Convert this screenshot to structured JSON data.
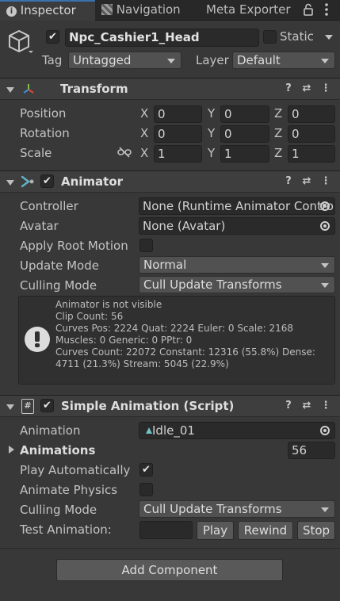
{
  "tabs": [
    {
      "label": "Inspector"
    },
    {
      "label": "Navigation"
    },
    {
      "label": "Meta Exporter"
    }
  ],
  "object": {
    "name": "Npc_Cashier1_Head",
    "static_label": "Static",
    "tag_label": "Tag",
    "tag_value": "Untagged",
    "layer_label": "Layer",
    "layer_value": "Default"
  },
  "transform": {
    "title": "Transform",
    "rows": [
      {
        "label": "Position",
        "x": "0",
        "y": "0",
        "z": "0"
      },
      {
        "label": "Rotation",
        "x": "0",
        "y": "0",
        "z": "0"
      },
      {
        "label": "Scale",
        "x": "1",
        "y": "1",
        "z": "1"
      }
    ],
    "axis": {
      "x": "X",
      "y": "Y",
      "z": "Z"
    }
  },
  "animator": {
    "title": "Animator",
    "controller_label": "Controller",
    "controller_value": "None (Runtime Animator Controller)",
    "avatar_label": "Avatar",
    "avatar_value": "None (Avatar)",
    "apply_root_motion_label": "Apply Root Motion",
    "update_mode_label": "Update Mode",
    "update_mode_value": "Normal",
    "culling_mode_label": "Culling Mode",
    "culling_mode_value": "Cull Update Transforms",
    "info_lines": [
      "Animator is not visible",
      "Clip Count: 56",
      "Curves Pos: 2224 Quat: 2224 Euler: 0 Scale: 2168",
      "Muscles: 0 Generic: 0 PPtr: 0",
      "Curves Count: 22072 Constant: 12316 (55.8%) Dense:",
      "4711 (21.3%) Stream: 5045 (22.9%)"
    ]
  },
  "simple_animation": {
    "title": "Simple Animation (Script)",
    "animation_label": "Animation",
    "animation_value": "Idle_01",
    "animations_label": "Animations",
    "animations_count": "56",
    "play_auto_label": "Play Automatically",
    "animate_physics_label": "Animate Physics",
    "culling_mode_label": "Culling Mode",
    "culling_mode_value": "Cull Update Transforms",
    "test_label": "Test Animation:",
    "play_button": "Play",
    "rewind_button": "Rewind",
    "stop_button": "Stop"
  },
  "add_component": "Add Component",
  "colors": {
    "accent": "#3a72b0",
    "panel": "#383838",
    "field": "#2a2a2a"
  }
}
